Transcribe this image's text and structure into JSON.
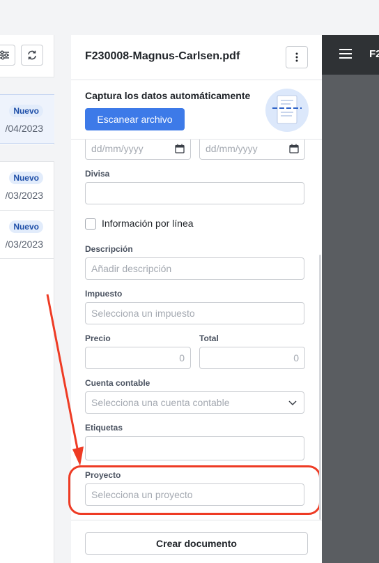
{
  "list": {
    "items": [
      {
        "status": "Nuevo",
        "date": "/04/2023"
      },
      {
        "status": "Nuevo",
        "date": "/03/2023"
      },
      {
        "status": "Nuevo",
        "date": "/03/2023"
      }
    ]
  },
  "form": {
    "file_name": "F230008-Magnus-Carlsen.pdf",
    "scan_title": "Captura los datos automáticamente",
    "scan_button": "Escanear archivo",
    "date_placeholder_1": "dd/mm/yyyy",
    "date_placeholder_2": "dd/mm/yyyy",
    "currency_label": "Divisa",
    "per_line_label": "Información por línea",
    "description_label": "Descripción",
    "description_placeholder": "Añadir descripción",
    "tax_label": "Impuesto",
    "tax_placeholder": "Selecciona un impuesto",
    "price_label": "Precio",
    "price_value": "0",
    "total_label": "Total",
    "total_value": "0",
    "account_label": "Cuenta contable",
    "account_placeholder": "Selecciona una cuenta contable",
    "tags_label": "Etiquetas",
    "project_label": "Proyecto",
    "project_placeholder": "Selecciona un proyecto",
    "create_button": "Crear documento"
  },
  "viewer": {
    "title": "F2"
  },
  "colors": {
    "primary": "#3d7ae8",
    "annotation": "#ee3b24",
    "badge_bg": "#e2ecfb",
    "badge_text": "#1f4fa8",
    "viewer_bg": "#5a5d61"
  }
}
